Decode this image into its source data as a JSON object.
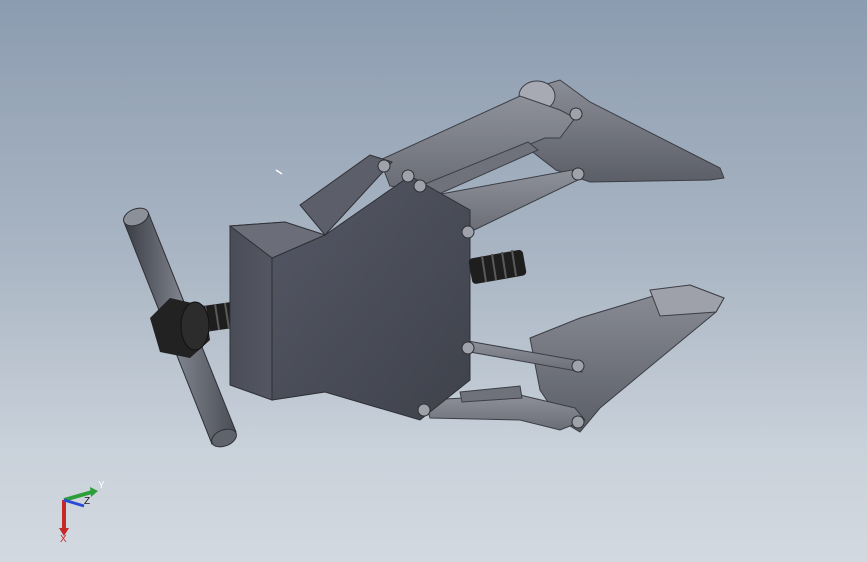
{
  "viewport": {
    "background_top": "#8c9cb0",
    "background_bottom": "#d3d9e0",
    "model_body_color": "#4a4d57",
    "model_link_color": "#7a7d86",
    "model_jaw_color": "#6d7079",
    "screw_color": "#1e1e1e"
  },
  "triad": {
    "x_label": "X",
    "y_label": "Y",
    "z_label": "Z",
    "x_color": "#c62828",
    "y_color": "#2e9e3a",
    "z_color": "#2b4bd4"
  }
}
